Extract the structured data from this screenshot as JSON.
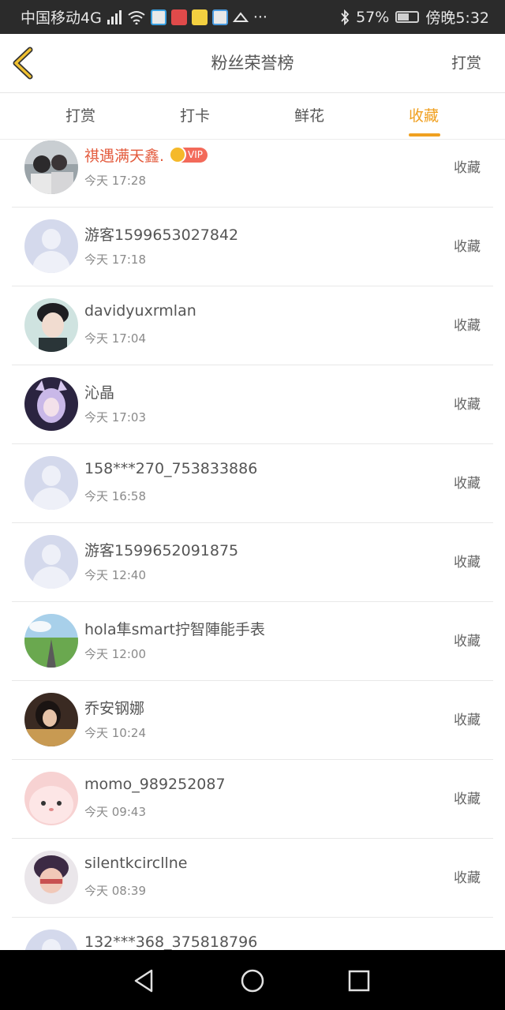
{
  "status_bar": {
    "carrier": "中国移动4G",
    "battery": "57%",
    "time": "傍晚5:32"
  },
  "header": {
    "title": "粉丝荣誉榜",
    "action": "打赏"
  },
  "tabs": [
    {
      "label": "打赏",
      "active": false
    },
    {
      "label": "打卡",
      "active": false
    },
    {
      "label": "鲜花",
      "active": false
    },
    {
      "label": "收藏",
      "active": true
    }
  ],
  "list": [
    {
      "name": "祺遇满天鑫.",
      "time": "今天 17:28",
      "action": "收藏",
      "vip": true,
      "vip_label": "VIP",
      "avatar": "photo"
    },
    {
      "name": "游客1599653027842",
      "time": "今天 17:18",
      "action": "收藏",
      "vip": false,
      "avatar": "default"
    },
    {
      "name": "davidyuxrmlan",
      "time": "今天 17:04",
      "action": "收藏",
      "vip": false,
      "avatar": "photo"
    },
    {
      "name": "沁晶",
      "time": "今天 17:03",
      "action": "收藏",
      "vip": false,
      "avatar": "photo"
    },
    {
      "name": "158***270_753833886",
      "time": "今天 16:58",
      "action": "收藏",
      "vip": false,
      "avatar": "default"
    },
    {
      "name": "游客1599652091875",
      "time": "今天 12:40",
      "action": "收藏",
      "vip": false,
      "avatar": "default"
    },
    {
      "name": "hola隼smart拧智陣能手表",
      "time": "今天 12:00",
      "action": "收藏",
      "vip": false,
      "avatar": "photo"
    },
    {
      "name": "乔安钢娜",
      "time": "今天 10:24",
      "action": "收藏",
      "vip": false,
      "avatar": "photo"
    },
    {
      "name": "momo_989252087",
      "time": "今天 09:43",
      "action": "收藏",
      "vip": false,
      "avatar": "photo"
    },
    {
      "name": "silentkcircllne",
      "time": "今天 08:39",
      "action": "收藏",
      "vip": false,
      "avatar": "photo"
    },
    {
      "name": "132***368_375818796",
      "time": "",
      "action": "",
      "vip": false,
      "avatar": "default"
    }
  ],
  "colors": {
    "accent": "#f0a020",
    "vip_name": "#e35a3c"
  }
}
